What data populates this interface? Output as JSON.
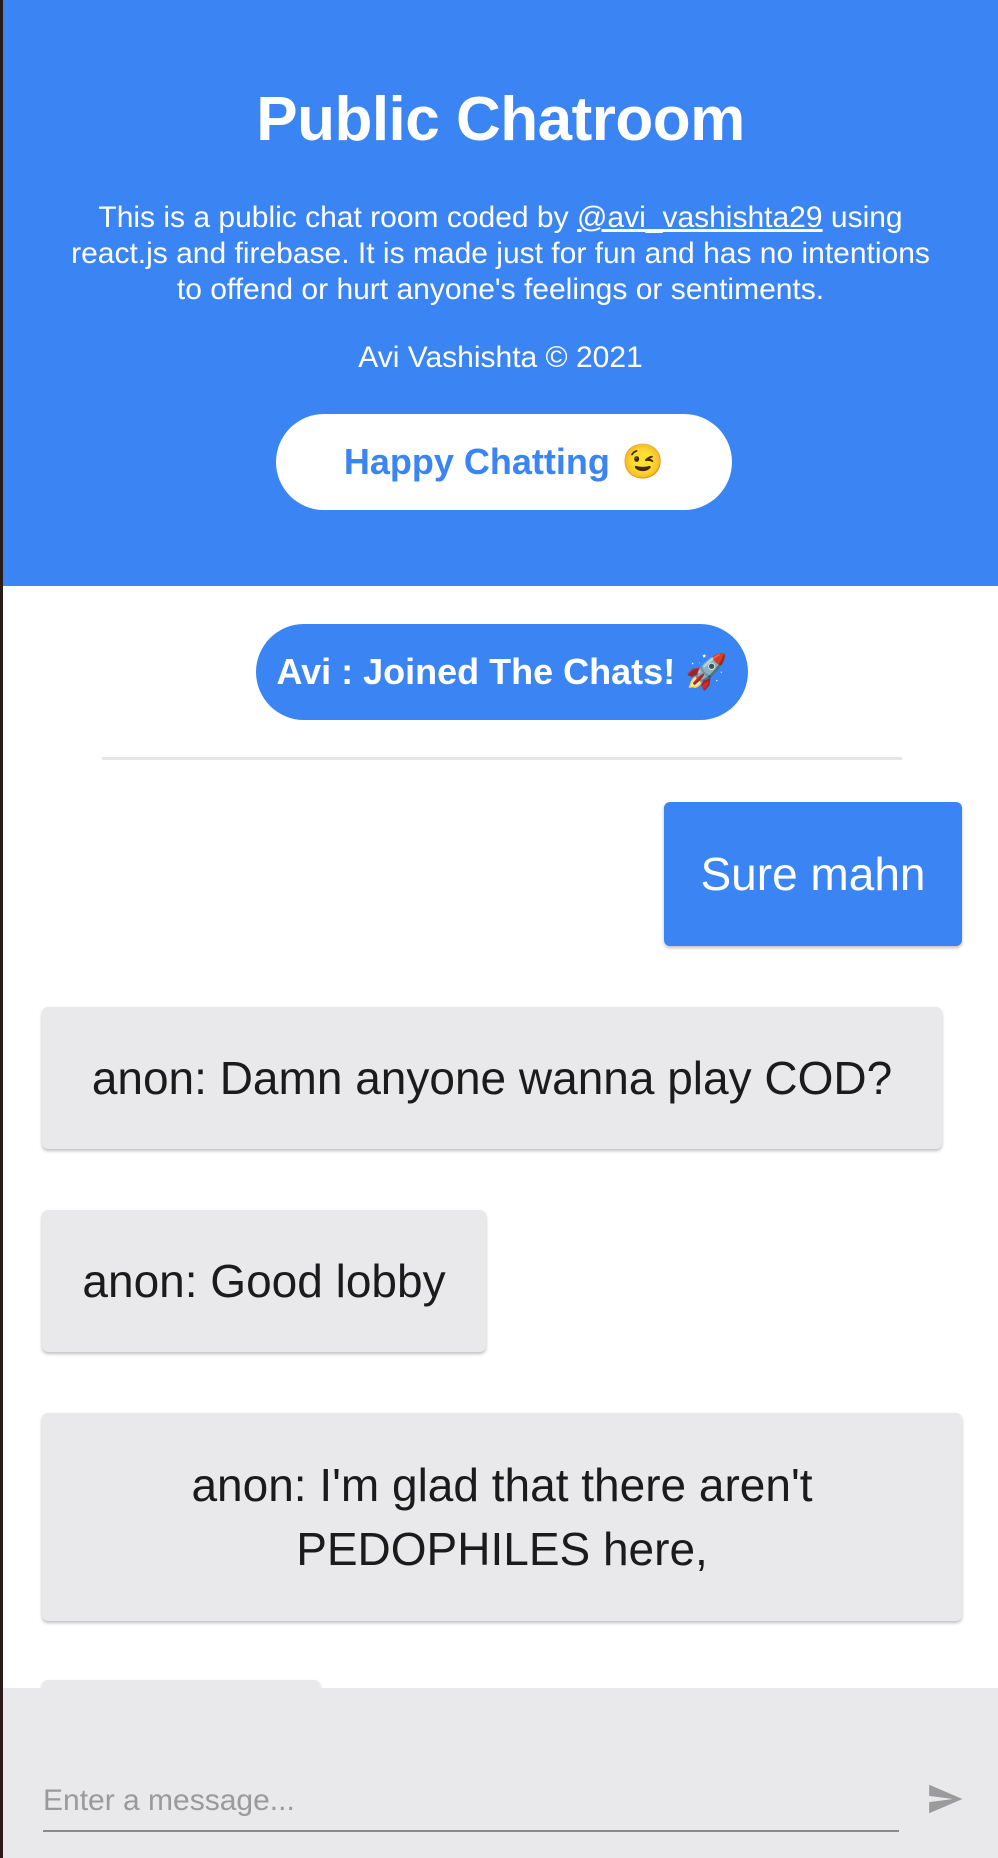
{
  "header": {
    "title": "Public Chatroom",
    "description_before": "This is a public chat room coded by ",
    "author_link": "@avi_vashishta29",
    "description_after": " using react.js and firebase. It is made just for fun and has no intentions to offend or hurt anyone's feelings or sentiments.",
    "copyright": "Avi Vashishta © 2021",
    "cta_label": "Happy Chatting",
    "cta_emoji": "😉"
  },
  "chat": {
    "joined_label": "Avi : Joined The Chats!",
    "joined_emoji": "🚀",
    "messages": [
      {
        "author": "self",
        "text": "Sure mahn"
      },
      {
        "author": "other",
        "text": "anon: Damn anyone wanna play COD?"
      },
      {
        "author": "other",
        "text": "anon: Good lobby"
      },
      {
        "author": "other",
        "text": "anon: I'm glad that there aren't PEDOPHILES here,"
      }
    ]
  },
  "composer": {
    "placeholder": "Enter a message...",
    "send_icon": "send-icon"
  },
  "colors": {
    "primary": "#3a85f3",
    "bubble_other": "#e9e9eb",
    "composer_bg": "#e9e9eb"
  }
}
